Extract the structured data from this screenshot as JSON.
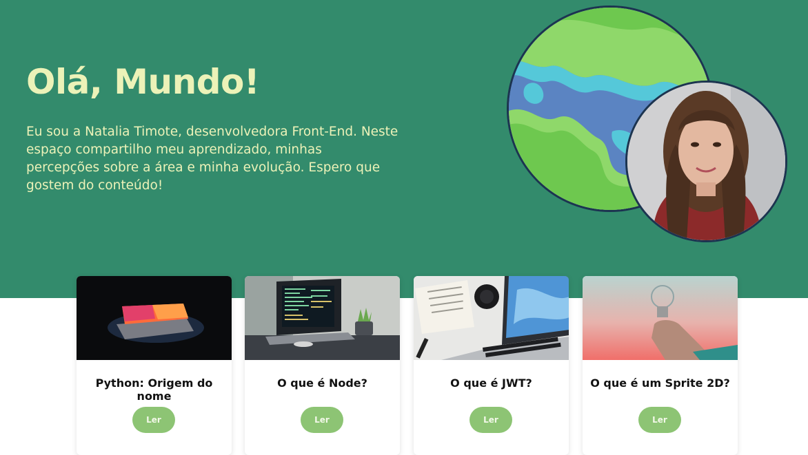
{
  "hero": {
    "title": "Olá, Mundo!",
    "description": "Eu sou a Natalia Timote, desenvolvedora Front-End. Neste espaço compartilho meu aprendizado, minhas percepções sobre a área e minha evolução. Espero que gostem do conteúdo!"
  },
  "colors": {
    "hero_bg": "#338b6c",
    "hero_text": "#ecf2b8",
    "button_bg": "#8dc474",
    "ring": "#1c3450"
  },
  "images": {
    "globe": "globe-illustration",
    "avatar": "profile-photo"
  },
  "cards": [
    {
      "title": "Python: Origem do nome",
      "button": "Ler",
      "image": "laptop-dark-glow"
    },
    {
      "title": "O que é Node?",
      "button": "Ler",
      "image": "laptop-code-desk"
    },
    {
      "title": "O que é JWT?",
      "button": "Ler",
      "image": "laptop-documents-desk"
    },
    {
      "title": "O que é um Sprite 2D?",
      "button": "Ler",
      "image": "hand-light-bulb"
    }
  ]
}
